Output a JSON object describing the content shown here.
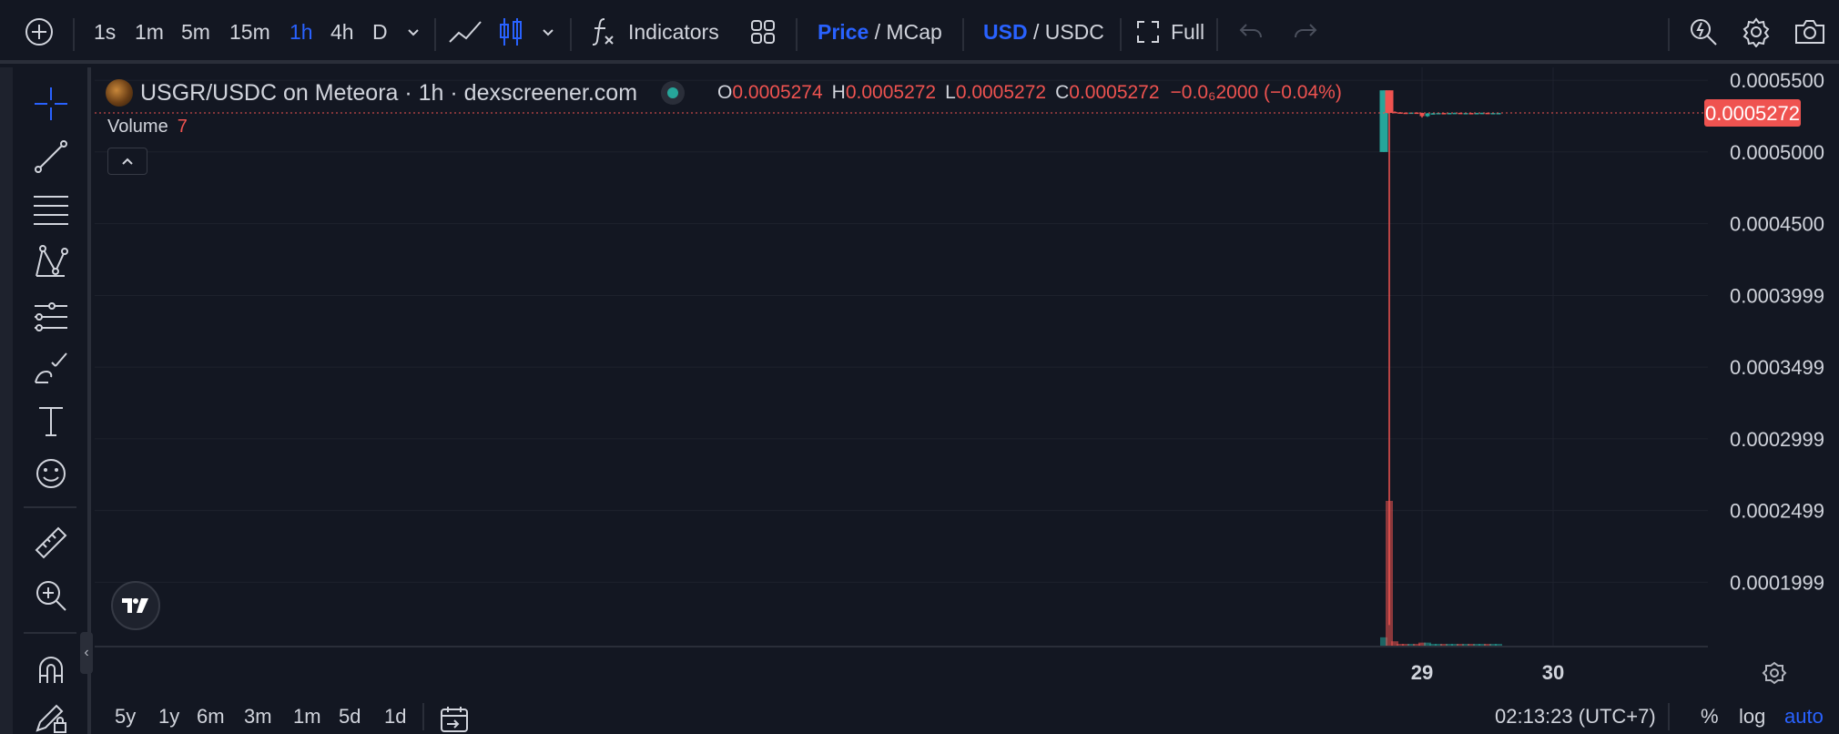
{
  "toolbar": {
    "add_icon": "plus-circle-icon",
    "timeframes": [
      "1s",
      "1m",
      "5m",
      "15m",
      "1h",
      "4h",
      "D"
    ],
    "active_timeframe": "1h",
    "indicators_label": "Indicators",
    "price_label": "Price",
    "mcap_label": " / MCap",
    "usd_label": "USD",
    "usdc_label": " / USDC",
    "full_label": "Full"
  },
  "legend": {
    "symbol_line": "USGR/USDC on Meteora · 1h · dexscreener.com",
    "open_key": "O",
    "open": "0.0005274",
    "high_key": "H",
    "high": "0.0005272",
    "low_key": "L",
    "low": "0.0005272",
    "close_key": "C",
    "close": "0.0005272",
    "change": "−0.0₆2000 (−0.04%)",
    "volume_label": "Volume",
    "volume_value": "7"
  },
  "bottom": {
    "ranges": [
      "5y",
      "1y",
      "6m",
      "3m",
      "1m",
      "5d",
      "1d"
    ],
    "clock": "02:13:23 (UTC+7)",
    "percent_label": "%",
    "log_label": "log",
    "auto_label": "auto"
  },
  "colors": {
    "background": "#131722",
    "up": "#26a69a",
    "down": "#ef5350",
    "accent": "#2962ff",
    "grid": "#1e222d",
    "text": "#d1d4dc"
  },
  "chart_data": {
    "type": "candlestick",
    "title": "USGR/USDC on Meteora · 1h · dexscreener.com",
    "interval": "1h",
    "y_axis_ticks": [
      "0.0005500",
      "0.0005000",
      "0.0004500",
      "0.0003999",
      "0.0003499",
      "0.0002999",
      "0.0002499",
      "0.0001999"
    ],
    "ylim": [
      0.000155,
      0.000559
    ],
    "last_price": "0.0005272",
    "x_axis_ticks": [
      {
        "label": "29",
        "bar": 7
      },
      {
        "label": "30",
        "bar": 31
      }
    ],
    "grid": true,
    "candles": [
      {
        "bar": 0,
        "open": 0.0005,
        "high": 0.000543,
        "low": 0.0005,
        "close": 0.000543,
        "volume": 7
      },
      {
        "bar": 1,
        "open": 0.000543,
        "high": 0.000543,
        "low": 0.00017,
        "close": 0.0005272,
        "volume": 110
      },
      {
        "bar": 2,
        "open": 0.000528,
        "high": 0.0005283,
        "low": 0.000527,
        "close": 0.0005276,
        "volume": 4
      },
      {
        "bar": 3,
        "open": 0.0005276,
        "high": 0.0005278,
        "low": 0.000527,
        "close": 0.0005274,
        "volume": 2
      },
      {
        "bar": 4,
        "open": 0.0005274,
        "high": 0.0005276,
        "low": 0.000527,
        "close": 0.0005273,
        "volume": 2
      },
      {
        "bar": 5,
        "open": 0.0005273,
        "high": 0.0005275,
        "low": 0.000527,
        "close": 0.0005275,
        "volume": 2
      },
      {
        "bar": 6,
        "open": 0.0005275,
        "high": 0.0005277,
        "low": 0.000527,
        "close": 0.0005272,
        "volume": 2
      },
      {
        "bar": 7,
        "open": 0.0005272,
        "high": 0.0005274,
        "low": 0.000524,
        "close": 0.000525,
        "volume": 3
      },
      {
        "bar": 8,
        "open": 0.000525,
        "high": 0.0005272,
        "low": 0.0005245,
        "close": 0.0005268,
        "volume": 3
      },
      {
        "bar": 9,
        "open": 0.0005268,
        "high": 0.0005272,
        "low": 0.0005262,
        "close": 0.000527,
        "volume": 2
      },
      {
        "bar": 10,
        "open": 0.000527,
        "high": 0.0005273,
        "low": 0.0005268,
        "close": 0.0005272,
        "volume": 2
      },
      {
        "bar": 11,
        "open": 0.0005272,
        "high": 0.0005273,
        "low": 0.000527,
        "close": 0.0005271,
        "volume": 2
      },
      {
        "bar": 12,
        "open": 0.0005271,
        "high": 0.0005273,
        "low": 0.000527,
        "close": 0.0005272,
        "volume": 2
      },
      {
        "bar": 13,
        "open": 0.0005272,
        "high": 0.0005274,
        "low": 0.000527,
        "close": 0.0005273,
        "volume": 2
      },
      {
        "bar": 14,
        "open": 0.0005273,
        "high": 0.0005274,
        "low": 0.000527,
        "close": 0.0005272,
        "volume": 2
      },
      {
        "bar": 15,
        "open": 0.0005272,
        "high": 0.0005273,
        "low": 0.0005271,
        "close": 0.0005272,
        "volume": 2
      },
      {
        "bar": 16,
        "open": 0.0005272,
        "high": 0.0005273,
        "low": 0.000527,
        "close": 0.0005271,
        "volume": 2
      },
      {
        "bar": 17,
        "open": 0.0005271,
        "high": 0.0005273,
        "low": 0.000527,
        "close": 0.0005272,
        "volume": 2
      },
      {
        "bar": 18,
        "open": 0.0005272,
        "high": 0.0005274,
        "low": 0.0005271,
        "close": 0.0005273,
        "volume": 2
      },
      {
        "bar": 19,
        "open": 0.0005273,
        "high": 0.0005274,
        "low": 0.0005271,
        "close": 0.0005272,
        "volume": 2
      },
      {
        "bar": 20,
        "open": 0.0005272,
        "high": 0.0005273,
        "low": 0.0005271,
        "close": 0.0005272,
        "volume": 2
      },
      {
        "bar": 21,
        "open": 0.0005272,
        "high": 0.0005273,
        "low": 0.0005271,
        "close": 0.0005272,
        "volume": 2
      }
    ]
  }
}
